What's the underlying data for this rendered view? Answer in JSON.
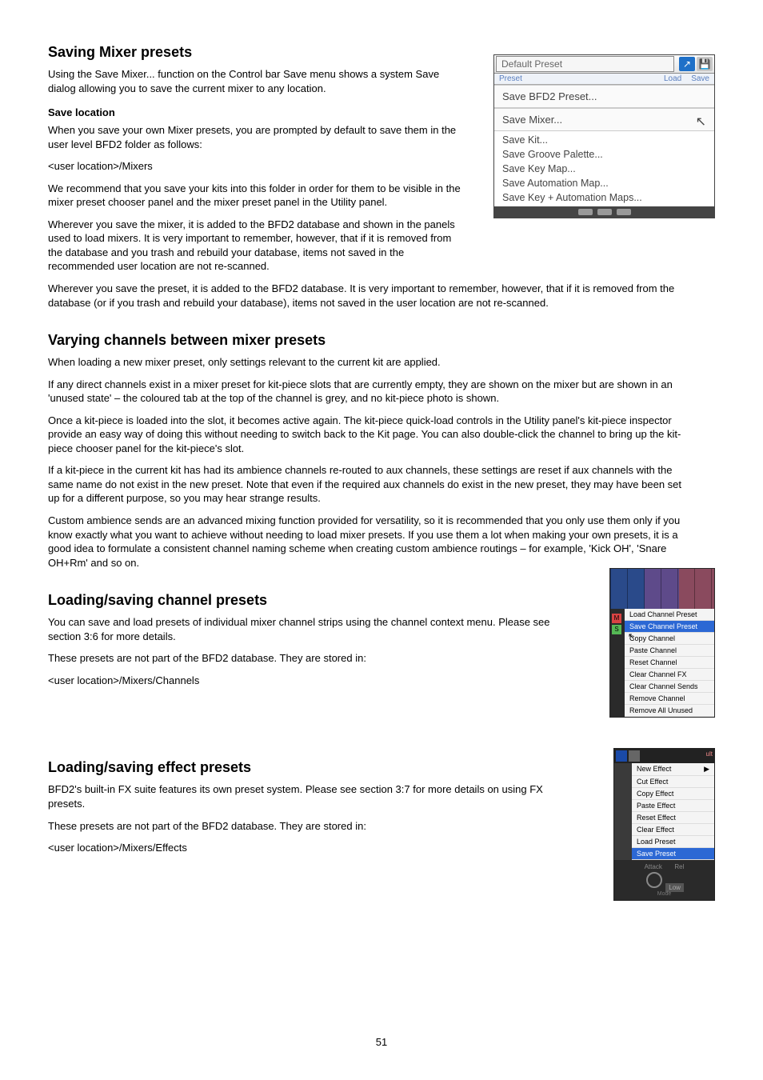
{
  "page_number": "51",
  "sec1": {
    "title": "Saving Mixer presets",
    "p1": "Using the Save Mixer... function on the Control bar Save menu shows a system Save dialog allowing you to save the current mixer to any location.",
    "h_saveloc": "Save location",
    "p2": "When you save your own Mixer presets, you are prompted by default to save them in the user level BFD2 folder as follows:",
    "p3": "<user location>/Mixers",
    "p4": "We recommend that you save your kits into this folder in order for them to be visible in the mixer preset chooser panel and the mixer preset panel in the Utility panel.",
    "p5": "Wherever you save the mixer, it is added to the BFD2 database and shown in the panels used to load mixers. It is very important to remember, however, that if it is removed from the database and you trash and rebuild your database, items not saved in the recommended user location are not re-scanned.",
    "p6": "Wherever you save the preset, it is added to the BFD2 database. It is very important to remember, however, that if it is removed from the database (or if you trash and rebuild your database), items not saved in the user location are not re-scanned."
  },
  "sec2": {
    "title": "Varying channels between mixer presets",
    "p1": "When loading a new mixer preset, only settings relevant to the current kit are applied.",
    "p2": "If any direct channels exist in a mixer preset for kit-piece slots that are currently empty, they are shown on the mixer but are shown in an 'unused state' – the coloured tab at the top of the channel is grey, and no kit-piece photo is shown.",
    "p3": "Once a kit-piece is loaded into the slot, it becomes active again. The kit-piece quick-load controls in the Utility panel's kit-piece inspector provide an easy way of doing this without needing to switch back to the Kit page. You can also double-click the channel to bring up the kit-piece chooser panel for the kit-piece's slot.",
    "p4": "If a kit-piece in the current kit has had its ambience channels re-routed to aux channels, these settings are reset if aux channels with the same name do not exist in the new preset. Note that even if the required aux channels do exist in the new preset, they may have been set up for a different purpose, so you may hear strange results.",
    "p5": "Custom ambience sends are an advanced mixing function provided for versatility, so it is recommended that you only use them only if you know exactly what you want to achieve without needing to load mixer presets. If you use them a lot when making your own presets, it is a good idea to formulate a consistent channel naming scheme when creating custom ambience routings – for example, 'Kick OH', 'Snare OH+Rm' and so on."
  },
  "sec3": {
    "title": "Loading/saving channel presets",
    "p1": "You can save and load presets of individual mixer channel strips using the channel context menu. Please see section 3:6 for more details.",
    "p2": "These presets are not part of the BFD2 database. They are stored in:",
    "p3": "<user location>/Mixers/Channels"
  },
  "sec4": {
    "title": "Loading/saving effect presets",
    "p1": "BFD2's built-in FX suite features its own preset system. Please see section 3:7 for more details on using FX presets.",
    "p2": "These presets are not part of the BFD2 database. They are stored in:",
    "p3": "<user location>/Mixers/Effects"
  },
  "savemenu": {
    "preset": "Default Preset",
    "sub_left": "Preset",
    "sub_load": "Load",
    "sub_save": "Save",
    "i0": "Save BFD2 Preset...",
    "i1": "Save Mixer...",
    "i2": "Save Kit...",
    "i3": "Save Groove Palette...",
    "i4": "Save Key Map...",
    "i5": "Save Automation Map...",
    "i6": "Save Key + Automation Maps..."
  },
  "channel_menu": {
    "m0": "Load Channel Preset",
    "m1": "Save Channel Preset",
    "m2": "Copy Channel",
    "m3": "Paste Channel",
    "m4": "Reset Channel",
    "m5": "Clear Channel FX",
    "m6": "Clear Channel Sends",
    "m7": "Remove Channel",
    "m8": "Remove All Unused",
    "badge_m": "M",
    "badge_s": "S"
  },
  "effect_menu": {
    "m0": "New Effect",
    "m1": "Cut Effect",
    "m2": "Copy Effect",
    "m3": "Paste Effect",
    "m4": "Reset Effect",
    "m5": "Clear Effect",
    "m6": "Load Preset",
    "m7": "Save Preset",
    "arrow": "▶",
    "attack": "Attack",
    "low": "Low",
    "mode": "Mode",
    "ult": "ult",
    "rel": "Rel"
  }
}
